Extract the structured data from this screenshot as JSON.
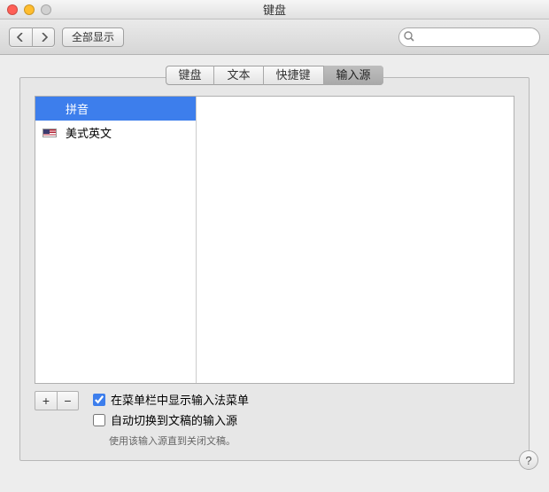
{
  "window": {
    "title": "键盘"
  },
  "toolbar": {
    "show_all_label": "全部显示",
    "search_placeholder": ""
  },
  "tabs": [
    {
      "label": "键盘",
      "active": false
    },
    {
      "label": "文本",
      "active": false
    },
    {
      "label": "快捷键",
      "active": false
    },
    {
      "label": "输入源",
      "active": true
    }
  ],
  "input_sources": [
    {
      "name": "拼音",
      "icon": "blank-icon",
      "selected": true
    },
    {
      "name": "美式英文",
      "icon": "us-flag-icon",
      "selected": false
    }
  ],
  "buttons": {
    "add": "+",
    "remove": "−"
  },
  "options": {
    "show_menu_label": "在菜单栏中显示输入法菜单",
    "show_menu_checked": true,
    "auto_switch_label": "自动切换到文稿的输入源",
    "auto_switch_checked": false,
    "hint": "使用该输入源直到关闭文稿。"
  },
  "help_tooltip": "?"
}
